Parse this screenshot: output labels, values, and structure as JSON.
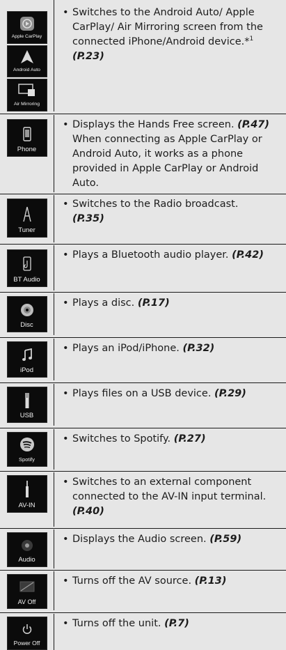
{
  "rows": [
    {
      "icons": [
        {
          "label": "Apple CarPlay",
          "icon": "carplay-icon"
        },
        {
          "label": "Android Auto",
          "icon": "android-auto-icon"
        },
        {
          "label": "Air Mirroring",
          "icon": "air-mirroring-icon"
        }
      ],
      "text": "Switches to the Android Auto/ Apple CarPlay/ Air Mirroring screen from the connected iPhone/Android device.*",
      "sup": "1",
      "ref": "(P.23)"
    },
    {
      "icons": [
        {
          "label": "Phone",
          "icon": "phone-icon"
        }
      ],
      "text": "Displays the Hands Free screen.",
      "ref": "(P.47)",
      "text_after": "When connecting as Apple CarPlay or Android Auto, it works as a phone provided in Apple CarPlay or Android Auto."
    },
    {
      "icons": [
        {
          "label": "Tuner",
          "icon": "tuner-icon"
        }
      ],
      "text": "Switches to the Radio broadcast.",
      "ref": "(P.35)"
    },
    {
      "icons": [
        {
          "label": "BT Audio",
          "icon": "bluetooth-audio-icon"
        }
      ],
      "text": "Plays a Bluetooth audio player.",
      "ref": "(P.42)"
    },
    {
      "icons": [
        {
          "label": "Disc",
          "icon": "disc-icon"
        }
      ],
      "text": "Plays a disc.",
      "ref": "(P.17)"
    },
    {
      "icons": [
        {
          "label": "iPod",
          "icon": "music-note-icon"
        }
      ],
      "text": "Plays an iPod/iPhone.",
      "ref": "(P.32)"
    },
    {
      "icons": [
        {
          "label": "USB",
          "icon": "usb-icon"
        }
      ],
      "text": "Plays files on a USB device.",
      "ref": "(P.29)"
    },
    {
      "icons": [
        {
          "label": "Spotify",
          "icon": "spotify-icon"
        }
      ],
      "text": "Switches to Spotify.",
      "ref": "(P.27)"
    },
    {
      "icons": [
        {
          "label": "AV-IN",
          "icon": "av-in-icon"
        }
      ],
      "text": "Switches to an external component connected to the AV-IN input terminal.",
      "ref": "(P.40)"
    },
    {
      "icons": [
        {
          "label": "Audio",
          "icon": "audio-icon"
        }
      ],
      "text": "Displays the Audio screen.",
      "ref": "(P.59)"
    },
    {
      "icons": [
        {
          "label": "AV Off",
          "icon": "av-off-icon"
        }
      ],
      "text": "Turns off the AV source.",
      "ref": "(P.13)"
    },
    {
      "icons": [
        {
          "label": "Power Off",
          "icon": "power-icon"
        }
      ],
      "text": "Turns off the unit.",
      "ref": "(P.7)"
    }
  ]
}
